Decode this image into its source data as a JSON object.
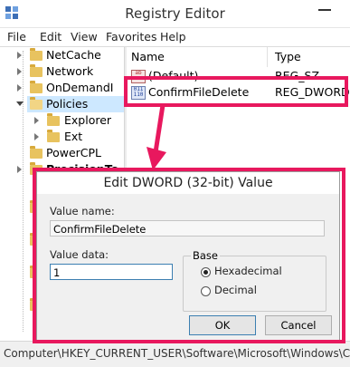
{
  "window": {
    "title": "Registry Editor",
    "icon": "registry-editor-icon"
  },
  "menu": [
    "File",
    "Edit",
    "View",
    "Favorites",
    "Help"
  ],
  "tree": {
    "items": [
      {
        "label": "NetCache",
        "expanded": false
      },
      {
        "label": "Network",
        "expanded": false
      },
      {
        "label": "OnDemandI",
        "expanded": false
      },
      {
        "label": "Policies",
        "expanded": true,
        "selected": true
      },
      {
        "label": "Explorer",
        "expanded": false
      },
      {
        "label": "Ext",
        "expanded": false
      },
      {
        "label": "PowerCPL",
        "expanded": false
      },
      {
        "label": "PrecisionTo",
        "expanded": false
      }
    ]
  },
  "list": {
    "columns": {
      "name": "Name",
      "type": "Type"
    },
    "rows": [
      {
        "name": "(Default)",
        "type": "REG_SZ"
      },
      {
        "name": "ConfirmFileDelete",
        "type": "REG_DWORD"
      }
    ]
  },
  "status": {
    "text": "Computer\\HKEY_CURRENT_USER\\Software\\Microsoft\\Windows\\Cu"
  },
  "dialog": {
    "title": "Edit DWORD (32-bit) Value",
    "value_name_label": "Value name:",
    "value_name": "ConfirmFileDelete",
    "value_data_label": "Value data:",
    "value_data": "1",
    "base_label": "Base",
    "base_options": [
      {
        "label": "Hexadecimal",
        "checked": true
      },
      {
        "label": "Decimal",
        "checked": false
      }
    ],
    "ok_label": "OK",
    "cancel_label": "Cancel"
  },
  "annotation": {
    "highlight_color": "#e8185e"
  }
}
